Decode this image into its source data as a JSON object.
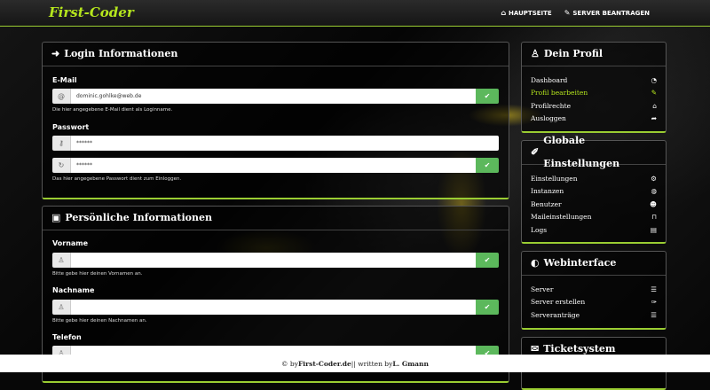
{
  "navbar": {
    "brand": "First-Coder",
    "links": [
      {
        "label": "HAUPTSEITE",
        "icon": "home-icon"
      },
      {
        "label": "SERVER BEANTRAGEN",
        "icon": "edit-icon"
      }
    ]
  },
  "login": {
    "title": "Login Informationen",
    "email_label": "E-Mail",
    "email_value": "dominic.gohlke@web.de",
    "email_help": "Die hier angegebene E-Mail dient als Loginname.",
    "password_label": "Passwort",
    "password_value": "******",
    "password_repeat_value": "******",
    "password_help": "Das hier angegebene Passwort dient zum Einloggen."
  },
  "personal": {
    "title": "Persönliche Informationen",
    "firstname_label": "Vorname",
    "firstname_value": "",
    "firstname_help": "Bitte gebe hier deinen Vornamen an.",
    "lastname_label": "Nachname",
    "lastname_value": "",
    "lastname_help": "Bitte gebe hier deinen Nachnamen an.",
    "phone_label": "Telefon",
    "phone_value": ""
  },
  "profile": {
    "title": "Dein Profil",
    "items": [
      {
        "label": "Dashboard",
        "icon": "dashboard-icon"
      },
      {
        "label": "Profil bearbeiten",
        "icon": "edit-icon",
        "active": true
      },
      {
        "label": "Profilrechte",
        "icon": "bank-icon"
      },
      {
        "label": "Ausloggen",
        "icon": "logout-icon"
      }
    ]
  },
  "global": {
    "title": "Globale Einstellungen",
    "items": [
      {
        "label": "Einstellungen",
        "icon": "cogs-icon"
      },
      {
        "label": "Instanzen",
        "icon": "globe-icon"
      },
      {
        "label": "Benutzer",
        "icon": "users-icon"
      },
      {
        "label": "Maileinstellungen",
        "icon": "inbox-icon"
      },
      {
        "label": "Logs",
        "icon": "archive-icon"
      }
    ]
  },
  "web": {
    "title": "Webinterface",
    "items": [
      {
        "label": "Server",
        "icon": "list-icon"
      },
      {
        "label": "Server erstellen",
        "icon": "brush-icon"
      },
      {
        "label": "Serveranträge",
        "icon": "list-icon"
      }
    ]
  },
  "ticket": {
    "title": "Ticketsystem"
  },
  "footer": {
    "prefix": "© by ",
    "site": "First-Coder.de",
    "middle": " || written by ",
    "author": "L. Gmann"
  },
  "colors": {
    "accent": "#b5e61d",
    "border_accent": "#9acd32",
    "success": "#5cb85c"
  }
}
